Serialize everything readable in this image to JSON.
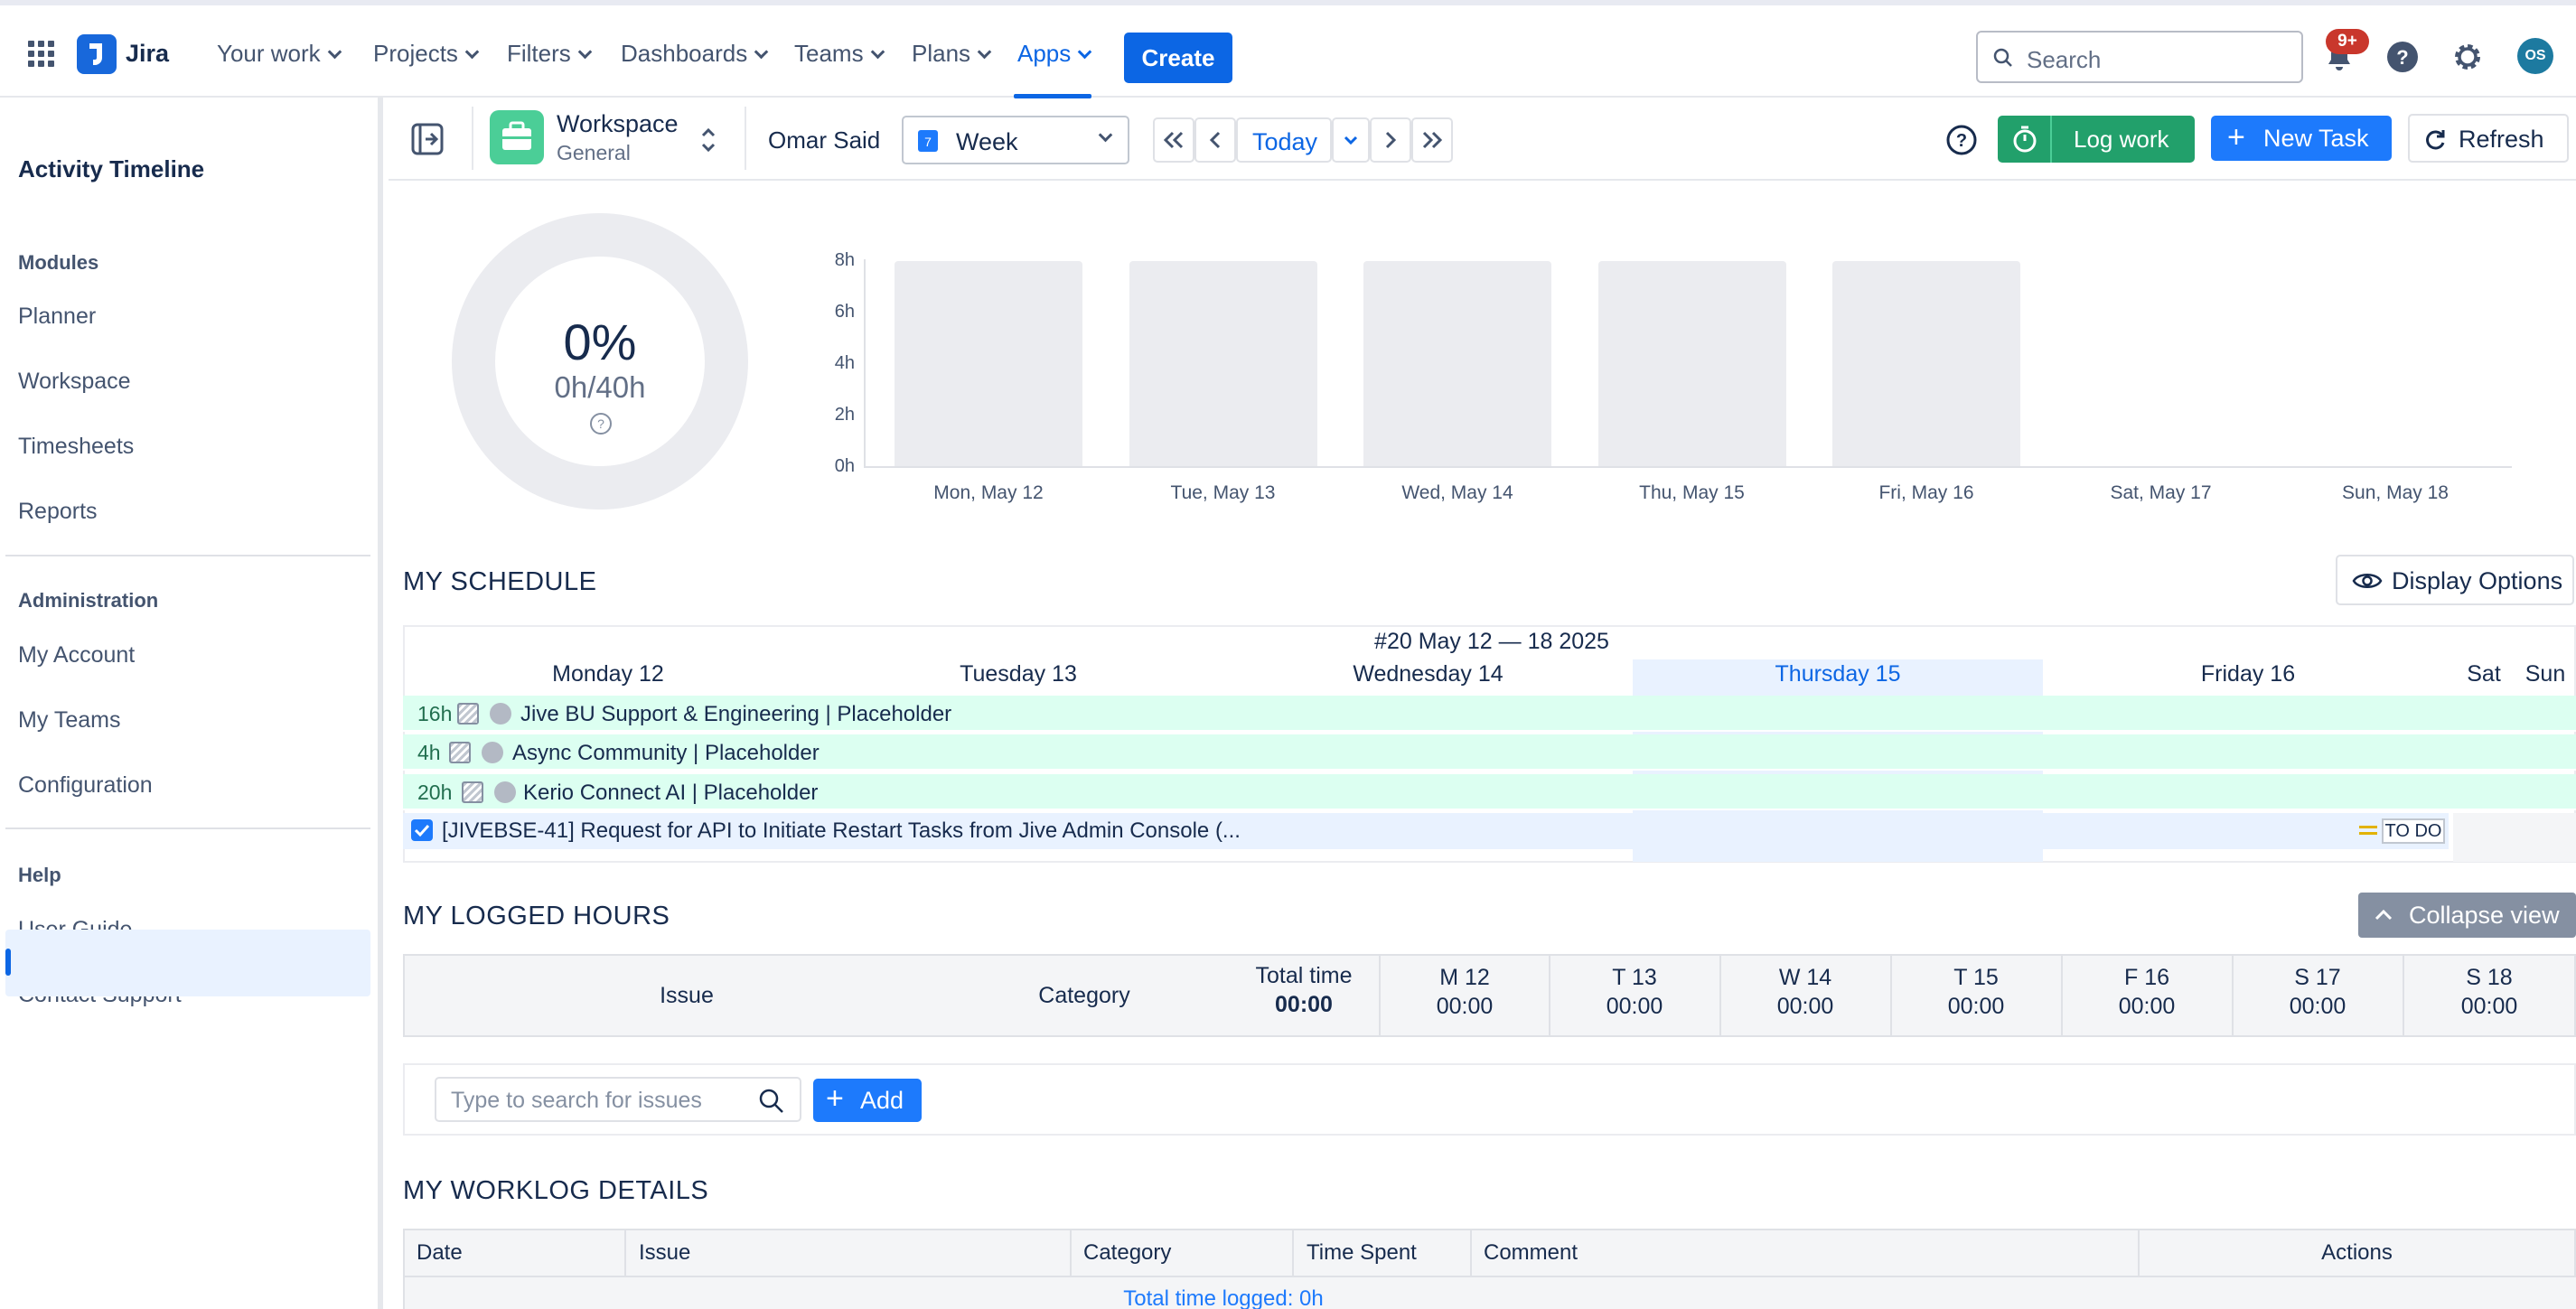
{
  "topnav": {
    "logo": "Jira",
    "items": [
      "Your work",
      "Projects",
      "Filters",
      "Dashboards",
      "Teams",
      "Plans",
      "Apps"
    ],
    "create": "Create",
    "search_placeholder": "Search",
    "notif_badge": "9+",
    "avatar": "OS"
  },
  "sidebar": {
    "title": "Activity Timeline",
    "modules_heading": "Modules",
    "modules": [
      "Planner",
      "Workspace",
      "Timesheets",
      "Reports"
    ],
    "admin_heading": "Administration",
    "admin": [
      "My Account",
      "My Teams",
      "Configuration"
    ],
    "help_heading": "Help",
    "help": [
      "User Guide",
      "Contact Support"
    ]
  },
  "toolbar": {
    "workspace_title": "Workspace",
    "workspace_sub": "General",
    "user": "Omar Said",
    "period": "Week",
    "period_icon_text": "7",
    "today": "Today",
    "log_work": "Log work",
    "new_task": "New Task",
    "refresh": "Refresh"
  },
  "summary": {
    "percent": "0%",
    "hours": "0h/40h"
  },
  "chart_data": {
    "type": "bar",
    "categories": [
      "Mon, May 12",
      "Tue, May 13",
      "Wed, May 14",
      "Thu, May 15",
      "Fri, May 16",
      "Sat, May 17",
      "Sun, May 18"
    ],
    "series": [
      {
        "values": [
          8,
          8,
          8,
          8,
          8,
          0,
          0
        ]
      }
    ],
    "yticks": [
      "8h",
      "6h",
      "4h",
      "2h",
      "0h"
    ],
    "ylim": [
      0,
      8
    ]
  },
  "schedule": {
    "title": "MY SCHEDULE",
    "display_options": "Display Options",
    "week_label": "#20 May 12 — 18 2025",
    "days": [
      "Monday 12",
      "Tuesday 13",
      "Wednesday 14",
      "Thursday 15",
      "Friday 16",
      "Sat",
      "Sun"
    ],
    "rows": [
      {
        "hours": "16h",
        "text": "Jive BU Support & Engineering | Placeholder"
      },
      {
        "hours": "4h",
        "text": "Async Community | Placeholder"
      },
      {
        "hours": "20h",
        "text": "Kerio Connect AI | Placeholder"
      }
    ],
    "task": {
      "text": "[JIVEBSE-41] Request for API to Initiate Restart Tasks from Jive Admin Console (...",
      "status": "TO DO"
    },
    "accent": "#0c66e4"
  },
  "logged_hours": {
    "title": "MY LOGGED HOURS",
    "collapse": "Collapse view",
    "col_issue": "Issue",
    "col_category": "Category",
    "col_total": "Total time",
    "total_value": "00:00",
    "days": [
      {
        "label": "M 12",
        "value": "00:00"
      },
      {
        "label": "T 13",
        "value": "00:00"
      },
      {
        "label": "W 14",
        "value": "00:00"
      },
      {
        "label": "T 15",
        "value": "00:00"
      },
      {
        "label": "F 16",
        "value": "00:00"
      },
      {
        "label": "S 17",
        "value": "00:00"
      },
      {
        "label": "S 18",
        "value": "00:00"
      }
    ],
    "search_placeholder": "Type to search for issues",
    "add": "Add"
  },
  "worklog": {
    "title": "MY WORKLOG DETAILS",
    "columns": [
      "Date",
      "Issue",
      "Category",
      "Time Spent",
      "Comment",
      "Actions"
    ],
    "total": "Total time logged: 0h"
  }
}
